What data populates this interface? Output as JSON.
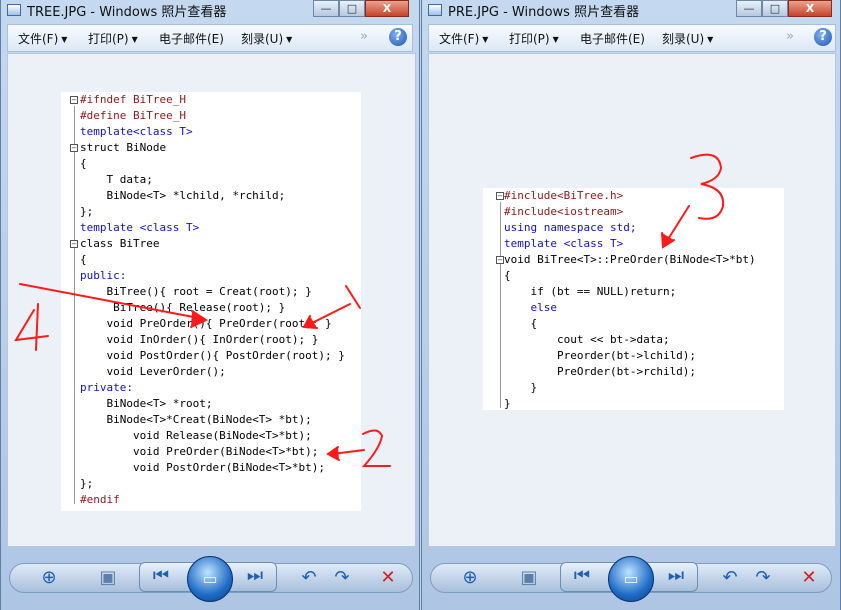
{
  "left_window": {
    "title": "TREE.JPG - Windows 照片查看器",
    "menu": [
      {
        "label": "文件(F)",
        "has_arrow": true
      },
      {
        "label": "打印(P)",
        "has_arrow": true
      },
      {
        "label": "电子邮件(E)",
        "has_arrow": false
      },
      {
        "label": "刻录(U)",
        "has_arrow": true
      }
    ],
    "more": "»",
    "help": "?",
    "code_lines": [
      "#ifndef BiTree_H",
      "#define BiTree_H",
      "template<class T>",
      "struct BiNode",
      "{",
      "    T data;",
      "    BiNode<T> *lchild, *rchild;",
      "};",
      "template <class T>",
      "class BiTree",
      "{",
      "public:",
      "    BiTree(){ root = Creat(root); }",
      "     BiTree(){ Release(root); }",
      "    void PreOrder(){ PreOrder(root); }",
      "    void InOrder(){ InOrder(root); }",
      "    void PostOrder(){ PostOrder(root); }",
      "    void LeverOrder();",
      "private:",
      "    BiNode<T> *root;",
      "    BiNode<T>*Creat(BiNode<T> *bt);",
      "        void Release(BiNode<T>*bt);",
      "        void PreOrder(BiNode<T>*bt);",
      "        void PostOrder(BiNode<T>*bt);",
      "};",
      "#endif"
    ],
    "annotations": [
      "4",
      "1",
      "2"
    ]
  },
  "right_window": {
    "title": "PRE.JPG - Windows 照片查看器",
    "menu": [
      {
        "label": "文件(F)",
        "has_arrow": true
      },
      {
        "label": "打印(P)",
        "has_arrow": true
      },
      {
        "label": "电子邮件(E)",
        "has_arrow": false
      },
      {
        "label": "刻录(U)",
        "has_arrow": true
      }
    ],
    "more": "»",
    "help": "?",
    "code_lines": [
      "#include<BiTree.h>",
      "#include<iostream>",
      "using namespace std;",
      "template <class T>",
      "void BiTree<T>::PreOrder(BiNode<T>*bt)",
      "{",
      "    if (bt == NULL)return;",
      "    else",
      "    {",
      "        cout << bt->data;",
      "        Preorder(bt->lchild);",
      "        PreOrder(bt->rchild);",
      "    }",
      "}"
    ],
    "annotations": [
      "3"
    ]
  },
  "window_buttons": {
    "minimize": "—",
    "maximize": "□",
    "close": "X"
  },
  "colors": {
    "annotation": "#ff1a1a",
    "keyword": "#1010c8",
    "include": "#8b1a1a"
  }
}
